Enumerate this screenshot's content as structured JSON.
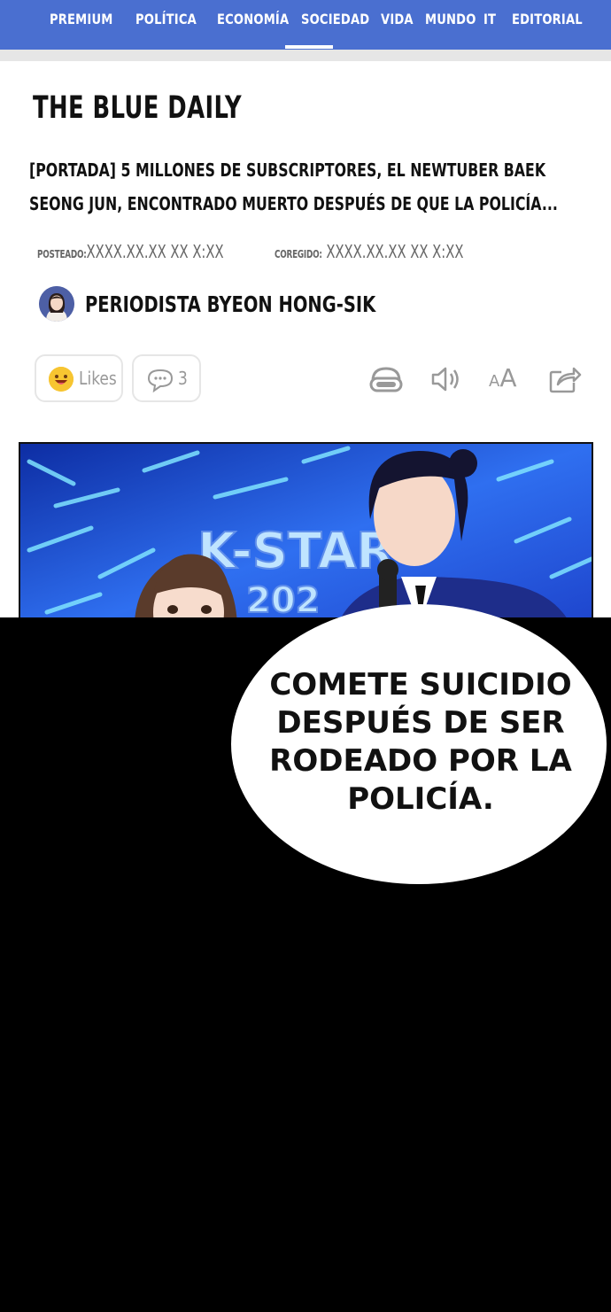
{
  "nav": {
    "items": [
      "PREMIUM",
      "POLÍTICA",
      "ECONOMÍA",
      "SOCIEDAD",
      "VIDA",
      "MUNDO",
      "IT",
      "EDITORIAL"
    ],
    "active": "SOCIEDAD",
    "color": "#4a6fd0"
  },
  "article": {
    "brand": "THE BLUE DAILY",
    "headline": "[PORTADA] 5 MILLONES DE SUBSCRIPTORES, EL NEWTUBER BAEK SEONG JUN, ENCONTRADO MUERTO DESPUÉS DE QUE LA POLICÍA...",
    "posted_label": "POSTEADO:",
    "posted_value": "XXXX.XX.XX XX X:XX",
    "corrected_label": "COREGIDO:",
    "corrected_value": "XXXX.XX.XX XX X:XX",
    "author": "PERIODISTA BYEON HONG-SIK"
  },
  "actions": {
    "likes_label": "Likes",
    "comments_count": "3",
    "icons": [
      "headphones-icon",
      "speaker-icon",
      "font-size-icon",
      "share-icon"
    ],
    "font_size_label": "AA"
  },
  "image": {
    "sign_text": "K-STAR",
    "sign_year": "202"
  },
  "speech": {
    "text": "COMETE SUICIDIO DESPUÉS DE SER RODEADO POR LA POLICÍA."
  }
}
